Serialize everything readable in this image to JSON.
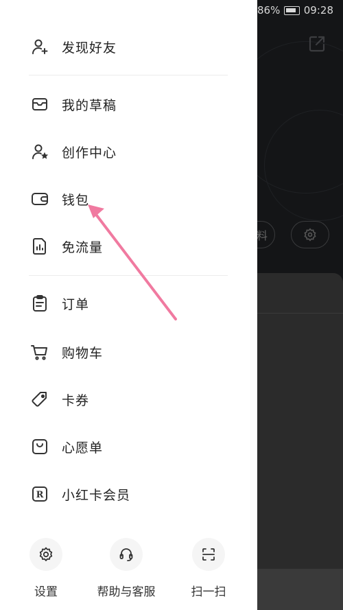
{
  "status": {
    "battery": "86%",
    "time": "09:28"
  },
  "background": {
    "pill_text": "料"
  },
  "menu": {
    "group1": [
      {
        "label": "发现好友",
        "icon": "add-friend-icon"
      }
    ],
    "group2": [
      {
        "label": "我的草稿",
        "icon": "drafts-icon"
      },
      {
        "label": "创作中心",
        "icon": "creator-center-icon"
      },
      {
        "label": "钱包",
        "icon": "wallet-icon"
      },
      {
        "label": "免流量",
        "icon": "data-free-icon"
      }
    ],
    "group3": [
      {
        "label": "订单",
        "icon": "clipboard-icon"
      },
      {
        "label": "购物车",
        "icon": "shopping-cart-icon"
      },
      {
        "label": "卡券",
        "icon": "ticket-icon"
      },
      {
        "label": "心愿单",
        "icon": "wishlist-bag-icon"
      },
      {
        "label": "小红卡会员",
        "icon": "r-badge-icon"
      }
    ]
  },
  "bottom": {
    "settings": "设置",
    "help": "帮助与客服",
    "scan": "扫一扫"
  },
  "colors": {
    "annotation_arrow": "#f07aa0",
    "text": "#222222",
    "icon": "#333333"
  }
}
